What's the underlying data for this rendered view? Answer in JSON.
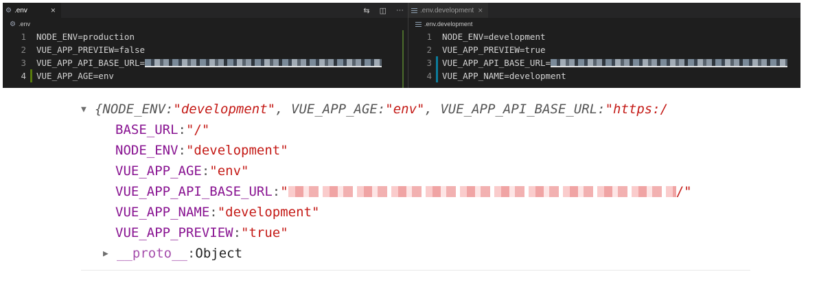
{
  "left_pane": {
    "tab_label": ".env",
    "tab_close": "×",
    "breadcrumb": ".env",
    "actions": [
      "⇆",
      "◫",
      "···"
    ],
    "lines": [
      {
        "n": "1",
        "text": "NODE_ENV=production"
      },
      {
        "n": "2",
        "text": "VUE_APP_PREVIEW=false"
      },
      {
        "n": "3",
        "text": "VUE_APP_API_BASE_URL="
      },
      {
        "n": "4",
        "text": "VUE_APP_AGE=env"
      }
    ]
  },
  "right_pane": {
    "tab_label": ".env.development",
    "tab_close": "×",
    "breadcrumb": ".env.development",
    "lines": [
      {
        "n": "1",
        "text": "NODE_ENV=development"
      },
      {
        "n": "2",
        "text": "VUE_APP_PREVIEW=true"
      },
      {
        "n": "3",
        "text": "VUE_APP_API_BASE_URL="
      },
      {
        "n": "4",
        "text": "VUE_APP_NAME=development"
      }
    ]
  },
  "console": {
    "summary": {
      "open_brace": "{",
      "k1": "NODE_ENV: ",
      "v1": "\"development\"",
      "k2": ", VUE_APP_AGE: ",
      "v2": "\"env\"",
      "k3": ", VUE_APP_API_BASE_URL: ",
      "v3": "\"https:/"
    },
    "props": [
      {
        "key": "BASE_URL",
        "value": "\"/\""
      },
      {
        "key": "NODE_ENV",
        "value": "\"development\""
      },
      {
        "key": "VUE_APP_AGE",
        "value": "\"env\""
      },
      {
        "key": "VUE_APP_API_BASE_URL",
        "value_prefix": "\"",
        "value_suffix": "/\""
      },
      {
        "key": "VUE_APP_NAME",
        "value": "\"development\""
      },
      {
        "key": "VUE_APP_PREVIEW",
        "value": "\"true\""
      }
    ],
    "proto_key": "__proto__",
    "proto_value": "Object",
    "colon": ": "
  },
  "colors": {
    "editor_bg": "#1e1e1e",
    "string_red": "#c41a16",
    "key_purple": "#881391"
  }
}
